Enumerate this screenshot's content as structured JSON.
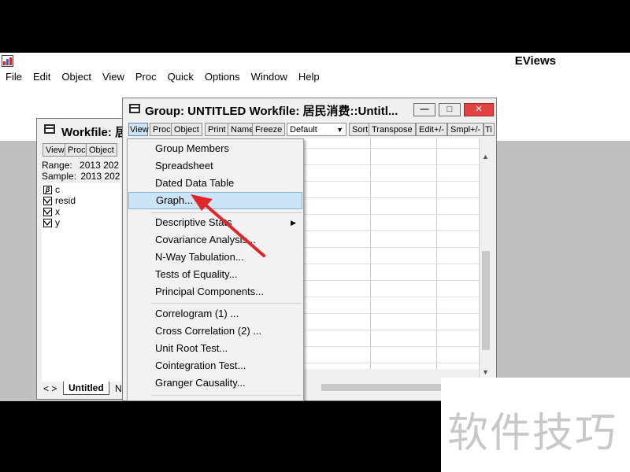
{
  "app": {
    "title": "EViews"
  },
  "menubar": [
    "File",
    "Edit",
    "Object",
    "View",
    "Proc",
    "Quick",
    "Options",
    "Window",
    "Help"
  ],
  "workfile_window": {
    "title": "Workfile: 居",
    "toolbar": [
      "View",
      "Proc",
      "Object"
    ],
    "range_label": "Range:",
    "range_value": "2013 202",
    "sample_label": "Sample:",
    "sample_value": "2013 202",
    "objects": [
      {
        "name": "c",
        "icon": "beta-coef-icon"
      },
      {
        "name": "resid",
        "icon": "series-icon"
      },
      {
        "name": "x",
        "icon": "series-icon"
      },
      {
        "name": "y",
        "icon": "series-icon"
      }
    ],
    "tabs": [
      "Untitled",
      "N"
    ],
    "nav_arrows": "< >"
  },
  "group_window": {
    "title": "Group: UNTITLED   Workfile: 居民消费::Untitl...",
    "controls": {
      "minimize": "—",
      "maximize": "□",
      "close": "✕"
    },
    "toolbar": [
      "View",
      "Proc",
      "Object",
      "Print",
      "Name",
      "Freeze"
    ],
    "display_select": "Default",
    "toolbar2": [
      "Sort",
      "Transpose",
      "Edit+/-",
      "Smpl+/-",
      "Ti"
    ]
  },
  "view_menu": {
    "items": [
      "Group Members",
      "Spreadsheet",
      "Dated Data Table",
      "Graph...",
      "Descriptive Stats",
      "Covariance Analysis...",
      "N-Way Tabulation...",
      "Tests of Equality...",
      "Principal Components...",
      "Correlogram (1) ...",
      "Cross Correlation (2) ...",
      "Unit Root Test...",
      "Cointegration Test...",
      "Granger Causality..."
    ],
    "highlighted": "Graph..."
  },
  "annotation_arrow_color": "#e0262a",
  "watermark": "软件技巧"
}
